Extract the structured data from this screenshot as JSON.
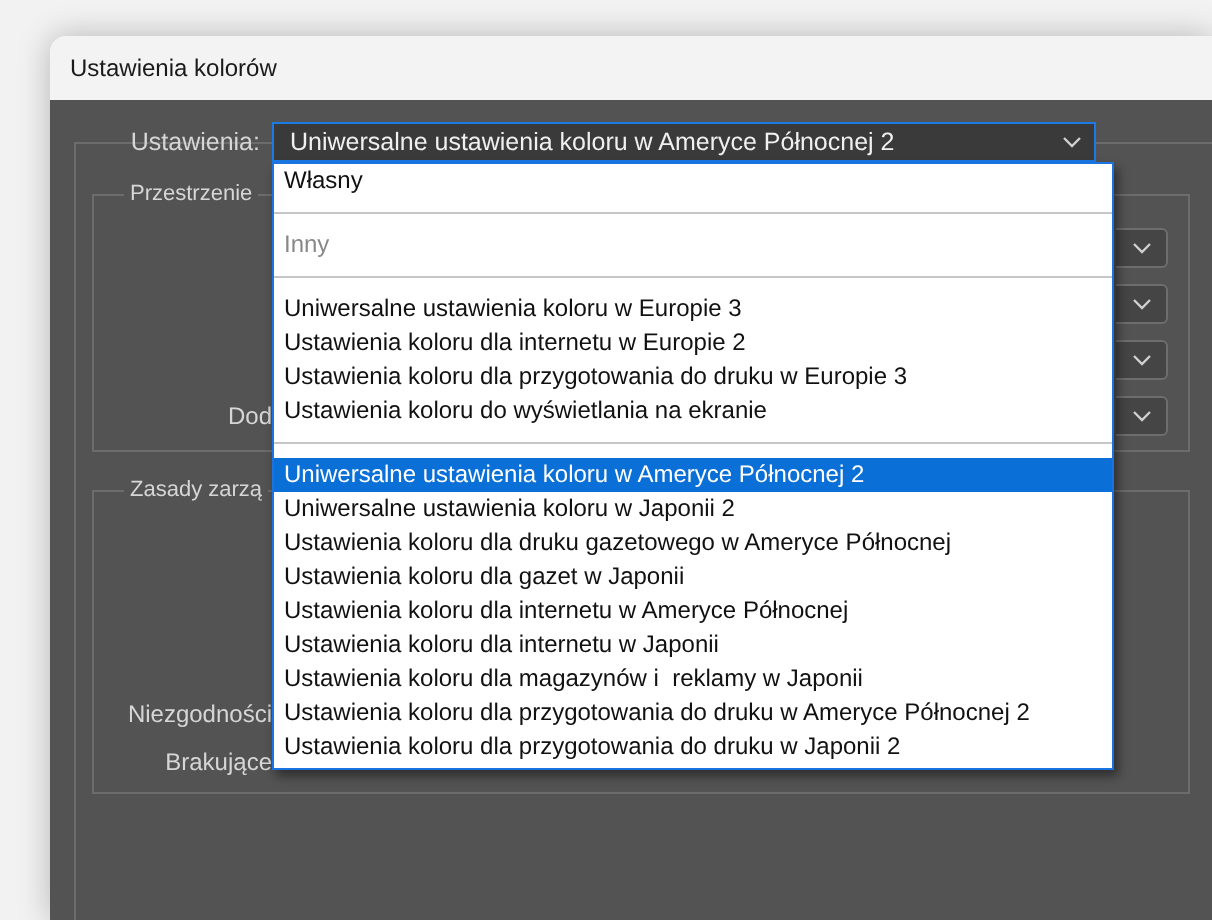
{
  "window": {
    "title": "Ustawienia kolorów"
  },
  "settings": {
    "label": "Ustawienia:",
    "value": "Uniwersalne ustawienia koloru w Ameryce Północnej 2"
  },
  "groups": [
    {
      "title": "Przestrzenie",
      "rows": [
        {
          "label": ""
        },
        {
          "label": ""
        },
        {
          "label": ""
        },
        {
          "label": "Dod"
        }
      ]
    },
    {
      "title": "Zasady zarzą",
      "rows": [
        {
          "label": "Niezgodności"
        },
        {
          "label": "Brakujące"
        }
      ]
    }
  ],
  "dropdown": {
    "sections": [
      {
        "items": [
          {
            "label": "Własny",
            "selected": false,
            "disabled": false
          }
        ]
      },
      {
        "items": [
          {
            "label": "Inny",
            "selected": false,
            "disabled": true
          }
        ]
      },
      {
        "items": [
          {
            "label": "Uniwersalne ustawienia koloru w Europie 3",
            "selected": false,
            "disabled": false
          },
          {
            "label": "Ustawienia koloru dla internetu w Europie 2",
            "selected": false,
            "disabled": false
          },
          {
            "label": "Ustawienia koloru dla przygotowania do druku w Europie 3",
            "selected": false,
            "disabled": false
          },
          {
            "label": "Ustawienia koloru do wyświetlania na ekranie",
            "selected": false,
            "disabled": false
          }
        ]
      },
      {
        "items": [
          {
            "label": "Uniwersalne ustawienia koloru w Ameryce Północnej 2",
            "selected": true,
            "disabled": false
          },
          {
            "label": "Uniwersalne ustawienia koloru w Japonii 2",
            "selected": false,
            "disabled": false
          },
          {
            "label": "Ustawienia koloru dla druku gazetowego w Ameryce Północnej",
            "selected": false,
            "disabled": false
          },
          {
            "label": "Ustawienia koloru dla gazet w Japonii",
            "selected": false,
            "disabled": false
          },
          {
            "label": "Ustawienia koloru dla internetu w Ameryce Północnej",
            "selected": false,
            "disabled": false
          },
          {
            "label": "Ustawienia koloru dla internetu w Japonii",
            "selected": false,
            "disabled": false
          },
          {
            "label": "Ustawienia koloru dla magazynów i  reklamy w Japonii",
            "selected": false,
            "disabled": false
          },
          {
            "label": "Ustawienia koloru dla przygotowania do druku w Ameryce Północnej 2",
            "selected": false,
            "disabled": false
          },
          {
            "label": "Ustawienia koloru dla przygotowania do druku w Japonii 2",
            "selected": false,
            "disabled": false
          }
        ]
      }
    ]
  }
}
